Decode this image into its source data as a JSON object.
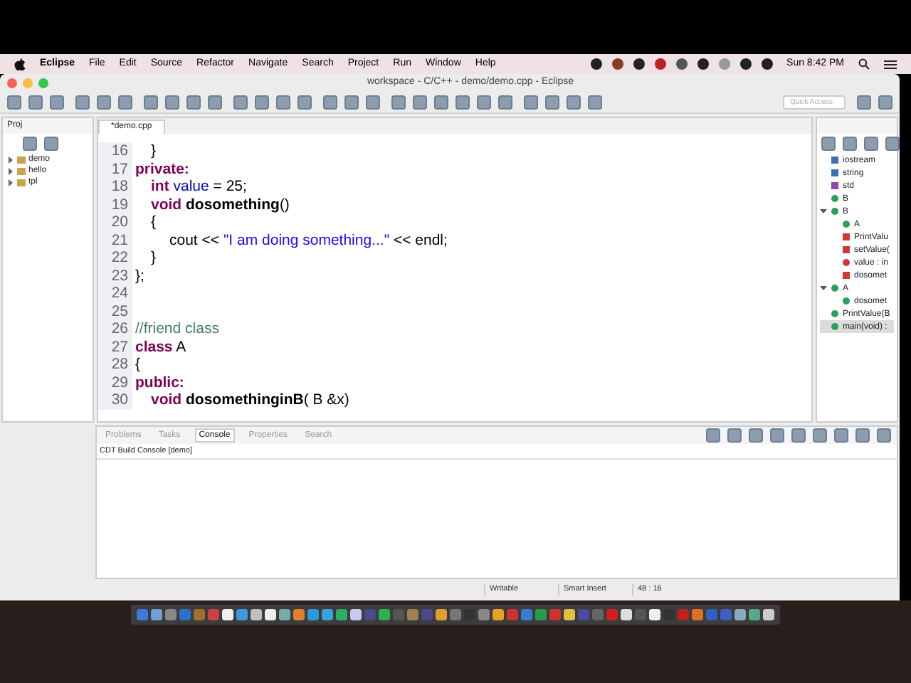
{
  "menu_bar": {
    "app": "Eclipse",
    "items": [
      "File",
      "Edit",
      "Source",
      "Refactor",
      "Navigate",
      "Search",
      "Project",
      "Run",
      "Window",
      "Help"
    ],
    "clock": "Sun 8:42 PM"
  },
  "window": {
    "title": "workspace - C/C++ - demo/demo.cpp - Eclipse"
  },
  "toolbar": {
    "quick_access": {
      "placeholder": "Quick Access"
    }
  },
  "project_explorer": {
    "tab": "Proj",
    "items": [
      {
        "label": "demo",
        "expanded": false
      },
      {
        "label": "hello",
        "expanded": false
      },
      {
        "label": "tpl",
        "expanded": false
      }
    ]
  },
  "editor": {
    "tab": "*demo.cpp",
    "lines": [
      {
        "number": "16",
        "kind": "indented",
        "segments": [
          {
            "kind": "plain",
            "text": "}"
          }
        ]
      },
      {
        "number": "17",
        "kind": "flush",
        "segments": [
          {
            "kind": "keyword",
            "text": "private:"
          }
        ]
      },
      {
        "number": "18",
        "kind": "indented",
        "segments": [
          {
            "kind": "keyword",
            "text": "int"
          },
          {
            "kind": "field",
            "text": " value"
          },
          {
            "kind": "plain",
            "text": " = 25;"
          }
        ]
      },
      {
        "number": "19",
        "kind": "indented",
        "segments": [
          {
            "kind": "keyword",
            "text": "void"
          },
          {
            "kind": "bold",
            "text": " dosomething"
          },
          {
            "kind": "plain",
            "text": "()"
          }
        ]
      },
      {
        "number": "20",
        "kind": "indented",
        "segments": [
          {
            "kind": "plain",
            "text": "{"
          }
        ]
      },
      {
        "number": "21",
        "kind": "nested",
        "segments": [
          {
            "kind": "plain",
            "text": "cout << "
          },
          {
            "kind": "string",
            "text": "\"I am doing something...\""
          },
          {
            "kind": "plain",
            "text": " << endl;"
          }
        ]
      },
      {
        "number": "22",
        "kind": "indented",
        "segments": [
          {
            "kind": "plain",
            "text": "}"
          }
        ]
      },
      {
        "number": "23",
        "kind": "flush",
        "segments": [
          {
            "kind": "plain",
            "text": "};"
          }
        ]
      },
      {
        "number": "24"
      },
      {
        "number": "25"
      },
      {
        "number": "26",
        "kind": "flush",
        "segments": [
          {
            "kind": "comment",
            "text": "//friend class"
          }
        ]
      },
      {
        "number": "27",
        "kind": "flush",
        "segments": [
          {
            "kind": "keyword",
            "text": "class"
          },
          {
            "kind": "plain",
            "text": " A"
          }
        ]
      },
      {
        "number": "28",
        "kind": "flush",
        "segments": [
          {
            "kind": "plain",
            "text": "{"
          }
        ]
      },
      {
        "number": "29",
        "kind": "flush",
        "segments": [
          {
            "kind": "keyword",
            "text": "public:"
          }
        ]
      },
      {
        "number": "30",
        "kind": "indented",
        "segments": [
          {
            "kind": "keyword",
            "text": "void"
          },
          {
            "kind": "bold",
            "text": " dosomethinginB"
          },
          {
            "kind": "plain",
            "text": "( B &x)"
          }
        ]
      }
    ]
  },
  "outline": {
    "items": [
      {
        "label": "iostream",
        "kind": "include",
        "selected": false
      },
      {
        "label": "string",
        "kind": "include",
        "selected": false
      },
      {
        "label": "std",
        "kind": "namespace",
        "selected": false
      },
      {
        "label": "B",
        "kind": "class-decl",
        "selected": false
      },
      {
        "label": "B",
        "kind": "class",
        "expanded": true,
        "selected": false,
        "children": [
          {
            "label": "A",
            "kind": "class-decl",
            "selected": false
          },
          {
            "label": "PrintValu",
            "kind": "private-method",
            "selected": false
          },
          {
            "label": "setValue(",
            "kind": "private-method",
            "selected": false
          },
          {
            "label": "value : in",
            "kind": "private-field",
            "selected": false
          },
          {
            "label": "dosomet",
            "kind": "private-method",
            "selected": false
          }
        ]
      },
      {
        "label": "A",
        "kind": "class",
        "expanded": true,
        "selected": false,
        "children": [
          {
            "label": "dosomet",
            "kind": "public-method",
            "selected": false
          }
        ]
      },
      {
        "label": "PrintValue(B",
        "kind": "function",
        "selected": false
      },
      {
        "label": "main(void) :",
        "kind": "function",
        "selected": true
      }
    ]
  },
  "bottom_panel": {
    "tabs": [
      {
        "label": "Problems",
        "selected": false
      },
      {
        "label": "Tasks",
        "selected": false
      },
      {
        "label": "Console",
        "selected": true
      },
      {
        "label": "Properties",
        "selected": false
      },
      {
        "label": "Search",
        "selected": false
      }
    ],
    "console_title": "CDT Build Console [demo]"
  },
  "status_bar": {
    "items": [
      "Writable",
      "Smart Insert",
      "48 : 16"
    ]
  }
}
